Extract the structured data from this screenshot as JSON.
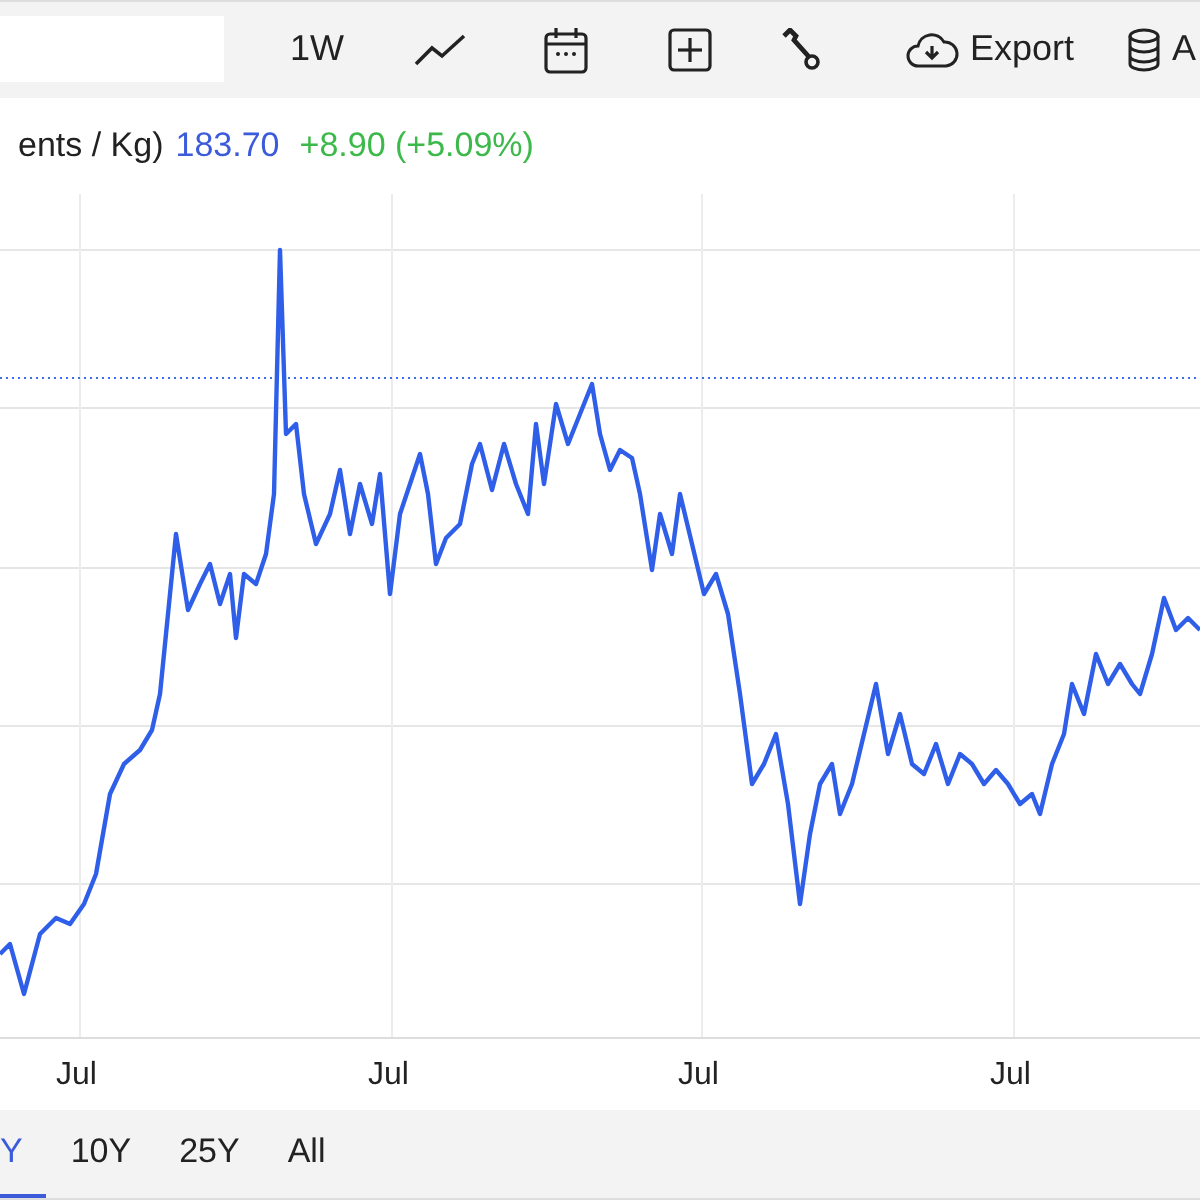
{
  "toolbar": {
    "interval": "1W",
    "export": "Export",
    "data_button": "A"
  },
  "legend": {
    "unit": "ents / Kg)",
    "price": "183.70",
    "change": "+8.90 (+5.09%)"
  },
  "chart": {
    "x_labels": [
      "Jul",
      "Jul",
      "Jul",
      "Jul"
    ]
  },
  "ranges": [
    {
      "label": "Y",
      "selected": true
    },
    {
      "label": "10Y",
      "selected": false
    },
    {
      "label": "25Y",
      "selected": false
    },
    {
      "label": "All",
      "selected": false
    }
  ]
}
